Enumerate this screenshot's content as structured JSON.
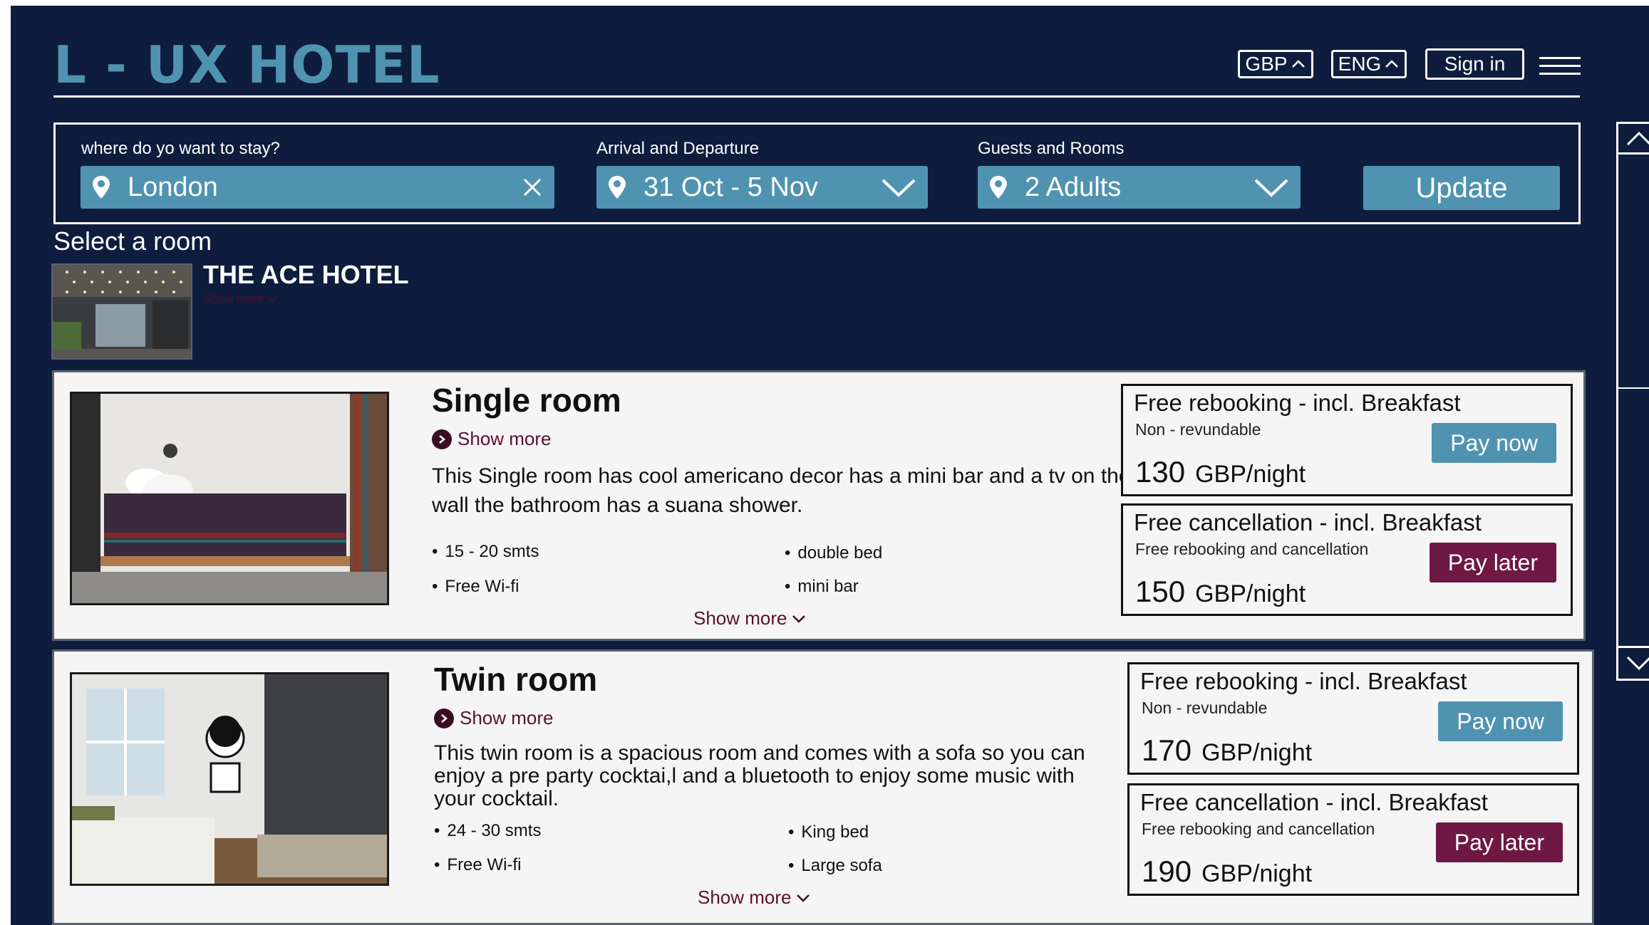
{
  "brand": {
    "logo": "L - UX HOTEL",
    "accent": "#4f93b1",
    "dark_accent": "#6e1843",
    "background": "#0e1d3d"
  },
  "header": {
    "currency": "GBP",
    "language": "ENG",
    "sign_in": "Sign in",
    "menu_icon": "hamburger-icon"
  },
  "search": {
    "destination_label": "where do yo want to stay?",
    "destination_value": "London",
    "dates_label": "Arrival and Departure",
    "dates_value": "31 Oct - 5 Nov",
    "guests_label": "Guests and Rooms",
    "guests_value": "2 Adults",
    "update": "Update"
  },
  "hotel": {
    "section_title": "Select a room",
    "name": "THE ACE HOTEL",
    "show_more": "Show more"
  },
  "rooms": [
    {
      "title": "Single room",
      "show_more": "Show more",
      "description": "This Single room has cool americano decor  has a mini bar and a tv on the wall the bathroom has a suana shower.",
      "amenities": [
        "15 - 20 smts",
        "double bed",
        "Free Wi-fi",
        "mini bar"
      ],
      "show_more_bottom": "Show more",
      "rates": [
        {
          "name": "Free rebooking - incl. Breakfast",
          "sub": "Non - revundable",
          "amount": "130",
          "unit": "GBP/night",
          "button": "Pay now"
        },
        {
          "name": "Free cancellation - incl. Breakfast",
          "sub": "Free rebooking and cancellation",
          "amount": "150",
          "unit": "GBP/night",
          "button": "Pay later"
        }
      ]
    },
    {
      "title": "Twin room",
      "show_more": "Show more",
      "description": "This twin room is a spacious room and comes with a sofa so you can enjoy a pre party cocktai,l and a bluetooth to enjoy some music with your cocktail.",
      "amenities": [
        "24 - 30 smts",
        "King bed",
        "Free Wi-fi",
        "Large sofa"
      ],
      "show_more_bottom": "Show more",
      "rates": [
        {
          "name": "Free rebooking - incl. Breakfast",
          "sub": "Non - revundable",
          "amount": "170",
          "unit": "GBP/night",
          "button": "Pay now"
        },
        {
          "name": "Free cancellation - incl. Breakfast",
          "sub": "Free rebooking and cancellation",
          "amount": "190",
          "unit": "GBP/night",
          "button": "Pay later"
        }
      ]
    }
  ]
}
